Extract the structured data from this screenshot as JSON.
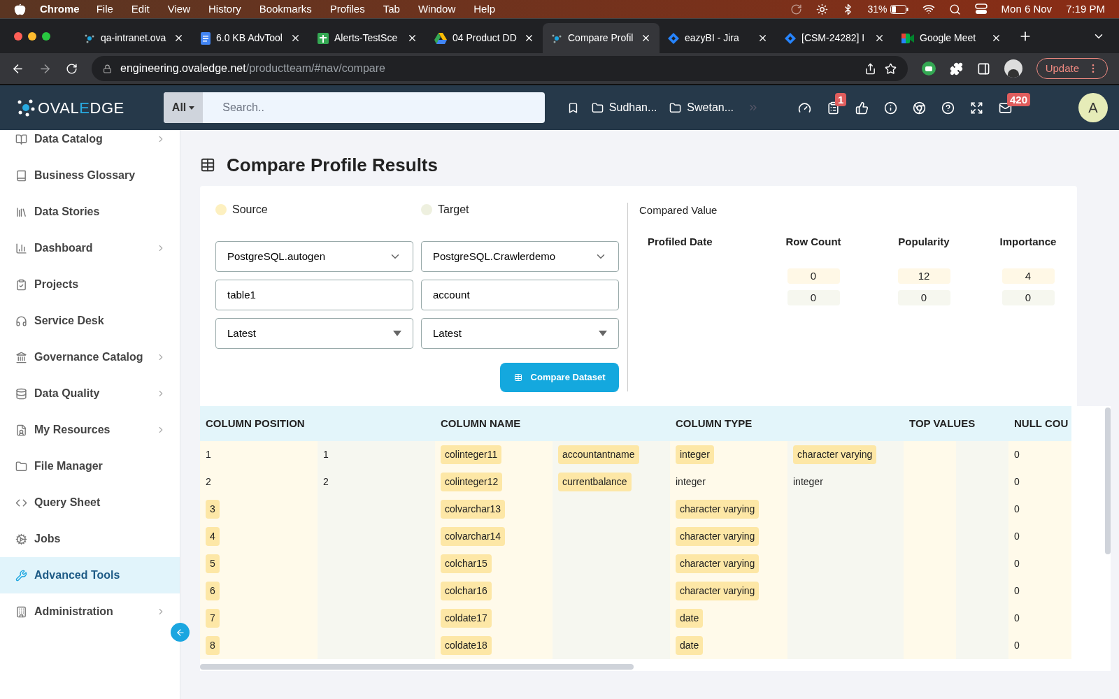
{
  "menubar": {
    "app": "Chrome",
    "menus": [
      "File",
      "Edit",
      "View",
      "History",
      "Bookmarks",
      "Profiles",
      "Tab",
      "Window",
      "Help"
    ],
    "battery": "31%",
    "date": "Mon 6 Nov",
    "time": "7:19 PM"
  },
  "browser": {
    "tabs": [
      {
        "title": "qa-intranet.ova",
        "kind": "network",
        "selected": false
      },
      {
        "title": "6.0 KB AdvTool",
        "kind": "document",
        "selected": false
      },
      {
        "title": "Alerts-TestSce",
        "kind": "sheet",
        "selected": false
      },
      {
        "title": "04 Product DD",
        "kind": "drive",
        "selected": false
      },
      {
        "title": "Compare Profil",
        "kind": "network",
        "selected": true
      },
      {
        "title": "eazyBI - Jira",
        "kind": "diamond",
        "selected": false
      },
      {
        "title": "[CSM-24282] I",
        "kind": "diamond",
        "selected": false
      },
      {
        "title": "Google Meet",
        "kind": "camera",
        "selected": false
      }
    ],
    "url_host": "engineering.ovaledge.net",
    "url_path": "/productteam/#nav/compare",
    "update_label": "Update"
  },
  "header": {
    "logo": {
      "before": "OVAL",
      "accent": "E",
      "after": "DGE"
    },
    "search": {
      "scope": "All",
      "placeholder": "Search.."
    },
    "folders": [
      "Sudhan...",
      "Swetan..."
    ],
    "tasks_badge": "1",
    "mail_badge": "420",
    "avatar": "A"
  },
  "sidebar": {
    "items": [
      {
        "label": "Data Catalog",
        "has_submenu": true,
        "selected": false
      },
      {
        "label": "Business Glossary",
        "has_submenu": false,
        "selected": false
      },
      {
        "label": "Data Stories",
        "has_submenu": false,
        "selected": false
      },
      {
        "label": "Dashboard",
        "has_submenu": true,
        "selected": false
      },
      {
        "label": "Projects",
        "has_submenu": false,
        "selected": false
      },
      {
        "label": "Service Desk",
        "has_submenu": false,
        "selected": false
      },
      {
        "label": "Governance Catalog",
        "has_submenu": true,
        "selected": false
      },
      {
        "label": "Data Quality",
        "has_submenu": true,
        "selected": false
      },
      {
        "label": "My Resources",
        "has_submenu": true,
        "selected": false
      },
      {
        "label": "File Manager",
        "has_submenu": false,
        "selected": false
      },
      {
        "label": "Query Sheet",
        "has_submenu": false,
        "selected": false
      },
      {
        "label": "Jobs",
        "has_submenu": false,
        "selected": false
      },
      {
        "label": "Advanced Tools",
        "has_submenu": false,
        "selected": true
      },
      {
        "label": "Administration",
        "has_submenu": true,
        "selected": false
      }
    ]
  },
  "page": {
    "title": "Compare Profile Results"
  },
  "compare_form": {
    "sides": [
      {
        "label": "Source",
        "color": "#fdf0c0",
        "connector": "PostgreSQL.autogen",
        "table": "table1",
        "profile": "Latest"
      },
      {
        "label": "Target",
        "color": "#eef0df",
        "connector": "PostgreSQL.Crawlerdemo",
        "table": "account",
        "profile": "Latest"
      }
    ],
    "button": "Compare Dataset"
  },
  "compared_value": {
    "title": "Compared Value",
    "columns": [
      {
        "label": "Profiled Date"
      },
      {
        "label": "Row Count",
        "source": "0",
        "target": "0"
      },
      {
        "label": "Popularity",
        "source": "12",
        "target": "0"
      },
      {
        "label": "Importance",
        "source": "4",
        "target": "0"
      }
    ]
  },
  "table": {
    "columns": [
      "COLUMN POSITION",
      "COLUMN NAME",
      "COLUMN TYPE",
      "TOP VALUES",
      "NULL COU"
    ],
    "rows": [
      {
        "position": {
          "source": "1",
          "target": "1",
          "differs": false
        },
        "name": {
          "source": "colinteger11",
          "target": "accountantname",
          "differs": true
        },
        "type": {
          "source": "integer",
          "target": "character varying",
          "differs": true
        },
        "null_count": "0"
      },
      {
        "position": {
          "source": "2",
          "target": "2",
          "differs": false
        },
        "name": {
          "source": "colinteger12",
          "target": "currentbalance",
          "differs": true
        },
        "type": {
          "source": "integer",
          "target": "integer",
          "differs": false
        },
        "null_count": "0"
      },
      {
        "position": {
          "source": "3",
          "differs": true
        },
        "name": {
          "source": "colvarchar13",
          "differs": true
        },
        "type": {
          "source": "character varying",
          "differs": true
        },
        "null_count": "0"
      },
      {
        "position": {
          "source": "4",
          "differs": true
        },
        "name": {
          "source": "colvarchar14",
          "differs": true
        },
        "type": {
          "source": "character varying",
          "differs": true
        },
        "null_count": "0"
      },
      {
        "position": {
          "source": "5",
          "differs": true
        },
        "name": {
          "source": "colchar15",
          "differs": true
        },
        "type": {
          "source": "character varying",
          "differs": true
        },
        "null_count": "0"
      },
      {
        "position": {
          "source": "6",
          "differs": true
        },
        "name": {
          "source": "colchar16",
          "differs": true
        },
        "type": {
          "source": "character varying",
          "differs": true
        },
        "null_count": "0"
      },
      {
        "position": {
          "source": "7",
          "differs": true
        },
        "name": {
          "source": "coldate17",
          "differs": true
        },
        "type": {
          "source": "date",
          "differs": true
        },
        "null_count": "0"
      },
      {
        "position": {
          "source": "8",
          "differs": true
        },
        "name": {
          "source": "coldate18",
          "differs": true
        },
        "type": {
          "source": "date",
          "differs": true
        },
        "null_count": "0"
      }
    ]
  }
}
